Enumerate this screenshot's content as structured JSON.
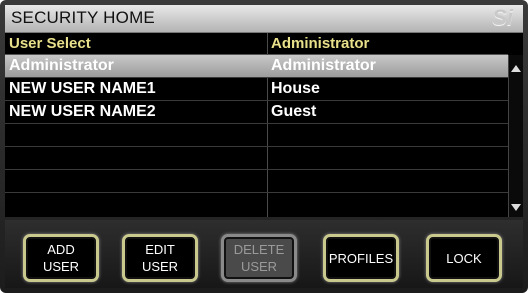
{
  "screen": {
    "title": "SECURITY HOME",
    "logo": "Si"
  },
  "table": {
    "headers": [
      "User Select",
      "Administrator"
    ],
    "rows": [
      {
        "user": "Administrator",
        "profile": "Administrator",
        "selected": true
      },
      {
        "user": "NEW USER NAME1",
        "profile": "House",
        "selected": false
      },
      {
        "user": "NEW USER NAME2",
        "profile": "Guest",
        "selected": false
      },
      {
        "user": "",
        "profile": "",
        "selected": false
      },
      {
        "user": "",
        "profile": "",
        "selected": false
      },
      {
        "user": "",
        "profile": "",
        "selected": false
      },
      {
        "user": "",
        "profile": "",
        "selected": false
      }
    ]
  },
  "buttons": {
    "add_line1": "ADD",
    "add_line2": "USER",
    "edit_line1": "EDIT",
    "edit_line2": "USER",
    "delete_line1": "DELETE",
    "delete_line2": "USER",
    "profiles": "PROFILES",
    "lock": "LOCK"
  },
  "colors": {
    "header_text": "#e8e08a",
    "button_border": "#c9c98e",
    "selected_row": "#b0b0b0"
  }
}
